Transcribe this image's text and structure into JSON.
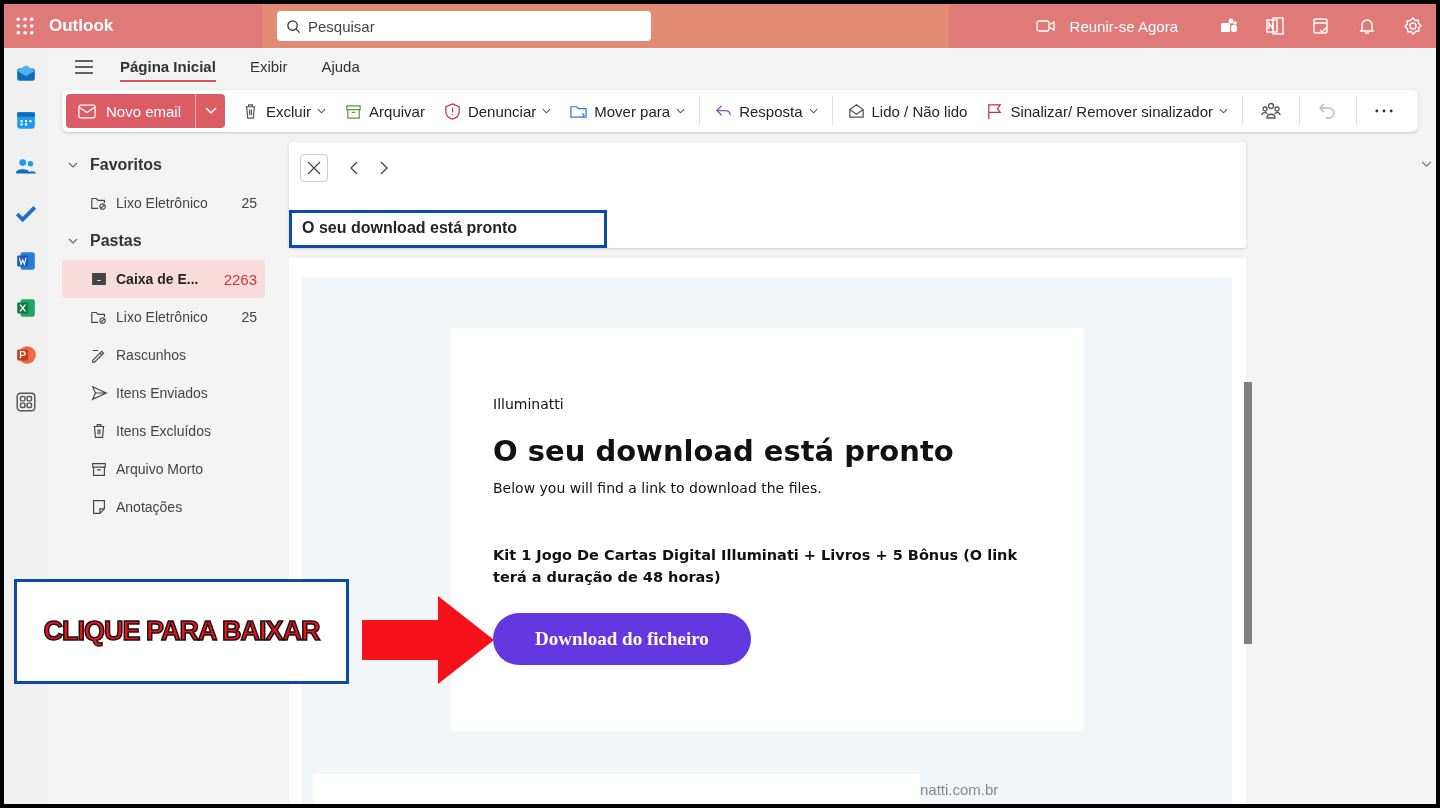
{
  "topbar": {
    "app_name": "Outlook",
    "search": {
      "placeholder": "Pesquisar"
    },
    "meet_now": "Reunir-se Agora"
  },
  "ribbon": {
    "tabs": [
      {
        "label": "Página Inicial",
        "selected": true
      },
      {
        "label": "Exibir",
        "selected": false
      },
      {
        "label": "Ajuda",
        "selected": false
      }
    ],
    "new_email": "Novo email",
    "actions": [
      {
        "kind": "delete",
        "label": "Excluir",
        "has_menu": true
      },
      {
        "kind": "archive",
        "label": "Arquivar",
        "has_menu": false
      },
      {
        "kind": "report",
        "label": "Denunciar",
        "has_menu": true
      },
      {
        "kind": "move",
        "label": "Mover para",
        "has_menu": true
      },
      {
        "kind": "reply",
        "label": "Resposta",
        "has_menu": true
      },
      {
        "kind": "read",
        "label": "Lido / Não lido",
        "has_menu": false
      },
      {
        "kind": "flag",
        "label": "Sinalizar/ Remover sinalizador",
        "has_menu": true
      }
    ]
  },
  "sections": [
    {
      "title": "Favoritos",
      "expanded": true,
      "items": [
        {
          "kind": "junk",
          "name": "Lixo Eletrônico",
          "count": "25",
          "selected": false
        }
      ]
    },
    {
      "title": "Pastas",
      "expanded": true,
      "items": [
        {
          "kind": "inbox",
          "name": "Caixa de E...",
          "count": "2263",
          "selected": true
        },
        {
          "kind": "junk",
          "name": "Lixo Eletrônico",
          "count": "25",
          "selected": false
        },
        {
          "kind": "drafts",
          "name": "Rascunhos",
          "selected": false
        },
        {
          "kind": "sent",
          "name": "Itens Enviados",
          "selected": false
        },
        {
          "kind": "deleted",
          "name": "Itens Excluídos",
          "selected": false
        },
        {
          "kind": "archive",
          "name": "Arquivo Morto",
          "selected": false
        },
        {
          "kind": "notes",
          "name": "Anotações",
          "selected": false
        }
      ]
    }
  ],
  "message": {
    "subject": "O seu download está pronto",
    "body": {
      "sender": "Illuminatti",
      "heading": "O seu download está pronto",
      "intro": "Below you will find a link to download the files.",
      "offer": "Kit 1 Jogo De Cartas Digital Illuminati + Livros + 5 Bônus (O link terá a duração de 48 horas)",
      "button": "Download do ficheiro",
      "footer_fragment": "natti.com.br"
    }
  },
  "annotation": {
    "callout": "CLIQUE PARA BAIXAR"
  }
}
